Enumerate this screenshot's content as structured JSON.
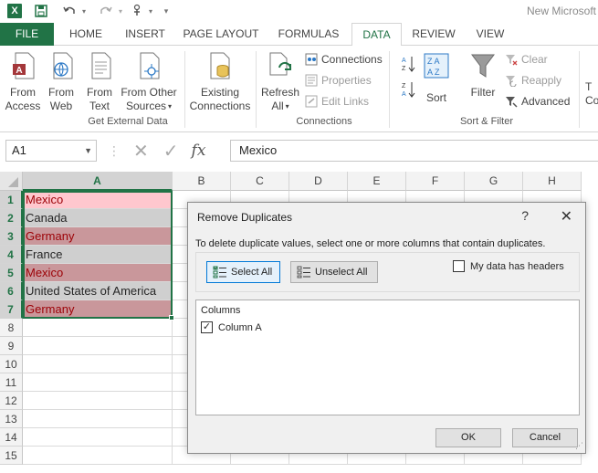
{
  "app": {
    "window_title": "New Microsoft",
    "logo_letter": "X"
  },
  "ribbon_tabs": [
    {
      "label": "FILE"
    },
    {
      "label": "HOME"
    },
    {
      "label": "INSERT"
    },
    {
      "label": "PAGE LAYOUT"
    },
    {
      "label": "FORMULAS"
    },
    {
      "label": "DATA"
    },
    {
      "label": "REVIEW"
    },
    {
      "label": "VIEW"
    }
  ],
  "active_tab": "DATA",
  "ribbon": {
    "get_external_data": {
      "label": "Get External Data",
      "from_access": [
        "From",
        "Access"
      ],
      "from_web": [
        "From",
        "Web"
      ],
      "from_text": [
        "From",
        "Text"
      ],
      "from_other": [
        "From Other",
        "Sources"
      ]
    },
    "existing_connections": [
      "Existing",
      "Connections"
    ],
    "connections": {
      "label": "Connections",
      "refresh_all": [
        "Refresh",
        "All"
      ],
      "connections_label": "Connections",
      "properties_label": "Properties",
      "edit_links_label": "Edit Links"
    },
    "sort_filter": {
      "label": "Sort & Filter",
      "sort_label": "Sort",
      "filter_label": "Filter",
      "clear_label": "Clear",
      "reapply_label": "Reapply",
      "advanced_label": "Advanced"
    },
    "cutoff": {
      "line1": "T",
      "line2": "Co"
    }
  },
  "formula_bar": {
    "name_box": "A1",
    "formula_value": "Mexico",
    "fx_symbol": "fx"
  },
  "sheet": {
    "columns": [
      "A",
      "B",
      "C",
      "D",
      "E",
      "F",
      "G",
      "H"
    ],
    "rows": [
      "1",
      "2",
      "3",
      "4",
      "5",
      "6",
      "7",
      "8",
      "9",
      "10",
      "11",
      "12",
      "13",
      "14",
      "15"
    ],
    "cells_col_a": [
      "Mexico",
      "Canada",
      "Germany",
      "France",
      "Mexico",
      "United States of America",
      "Germany"
    ],
    "duplicate_highlight_color": "#ffc7ce",
    "duplicate_text_color": "#9c0006",
    "selection_color": "#217346"
  },
  "dialog": {
    "title": "Remove Duplicates",
    "help": "?",
    "close": "✕",
    "description": "To delete duplicate values, select one or more columns that contain duplicates.",
    "select_all": "Select All",
    "unselect_all": "Unselect All",
    "my_data_has_headers": "My data has headers",
    "headers_checked": false,
    "columns_header": "Columns",
    "column_items": [
      {
        "label": "Column A",
        "checked": true
      }
    ],
    "ok": "OK",
    "cancel": "Cancel"
  }
}
